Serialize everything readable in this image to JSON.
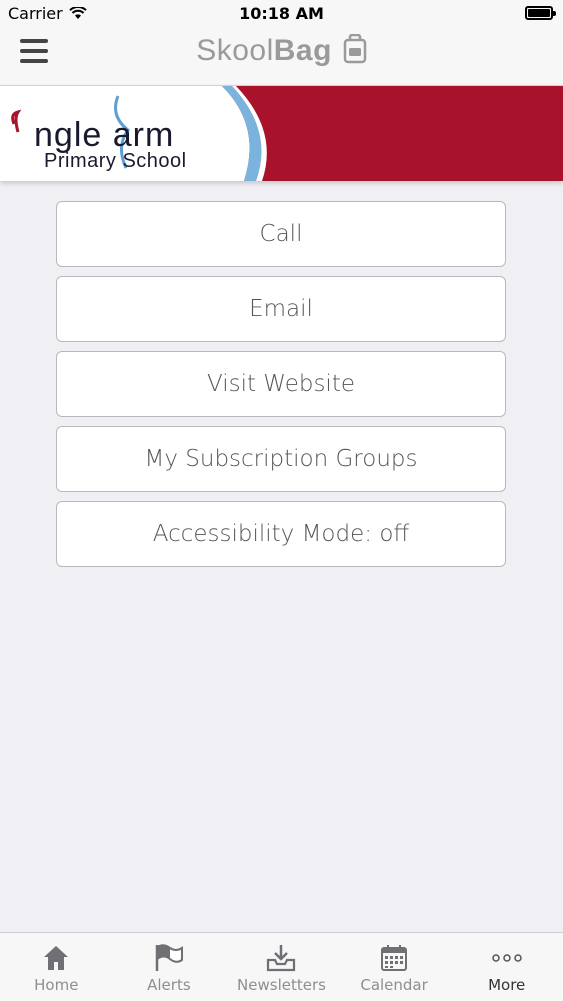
{
  "status_bar": {
    "carrier": "Carrier",
    "time": "10:18 AM"
  },
  "nav": {
    "logo_light": "Skool",
    "logo_bold": "Bag"
  },
  "banner": {
    "school_line1": "ngle  arm",
    "school_line2": "Primary School",
    "colors": {
      "red": "#a8122b",
      "blue": "#7ab3dd"
    }
  },
  "menu": {
    "items": [
      {
        "label": "Call"
      },
      {
        "label": "Email"
      },
      {
        "label": "Visit Website"
      },
      {
        "label": "My Subscription Groups"
      },
      {
        "label": "Accessibility Mode: off"
      }
    ]
  },
  "tabs": [
    {
      "label": "Home",
      "icon": "home-icon"
    },
    {
      "label": "Alerts",
      "icon": "flag-icon"
    },
    {
      "label": "Newsletters",
      "icon": "inbox-download-icon"
    },
    {
      "label": "Calendar",
      "icon": "calendar-icon"
    },
    {
      "label": "More",
      "icon": "more-dots-icon",
      "active": true
    }
  ]
}
